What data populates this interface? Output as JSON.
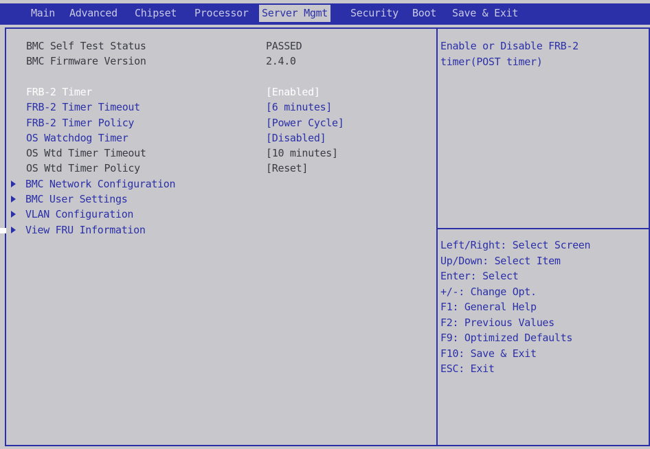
{
  "menu": {
    "tabs": [
      {
        "label": "Main"
      },
      {
        "label": "Advanced"
      },
      {
        "label": "Chipset"
      },
      {
        "label": "Processor"
      },
      {
        "label": "Server Mgmt"
      },
      {
        "label": "Security"
      },
      {
        "label": "Boot"
      },
      {
        "label": "Save & Exit"
      }
    ],
    "active_tab": "Server Mgmt"
  },
  "info": [
    {
      "label": "BMC Self Test Status",
      "value": "PASSED"
    },
    {
      "label": "BMC Firmware Version",
      "value": "2.4.0"
    }
  ],
  "settings": [
    {
      "label": "FRB-2 Timer",
      "value": "[Enabled]"
    },
    {
      "label": "FRB-2 Timer Timeout",
      "value": "[6 minutes]"
    },
    {
      "label": "FRB-2 Timer Policy",
      "value": "[Power Cycle]"
    },
    {
      "label": "OS Watchdog Timer",
      "value": "[Disabled]"
    },
    {
      "label": "OS Wtd Timer Timeout",
      "value": "[10 minutes]"
    },
    {
      "label": "OS Wtd Timer Policy",
      "value": "[Reset]"
    }
  ],
  "submenus": [
    {
      "label": "BMC Network Configuration"
    },
    {
      "label": "BMC User Settings"
    },
    {
      "label": "VLAN Configuration"
    },
    {
      "label": "View FRU Information"
    }
  ],
  "help": {
    "description": [
      "Enable or Disable FRB-2",
      "timer(POST timer)"
    ],
    "keys": [
      "Left/Right: Select Screen",
      "Up/Down: Select Item",
      "Enter: Select",
      "+/-: Change Opt.",
      "F1: General Help",
      "F2: Previous Values",
      "F9: Optimized Defaults",
      "F10: Save & Exit",
      "ESC: Exit"
    ]
  },
  "colors": {
    "background": "#c8c8cc",
    "accent": "#2b2fa8",
    "selected_text": "#ffffff",
    "static_text": "#3a3a44"
  }
}
